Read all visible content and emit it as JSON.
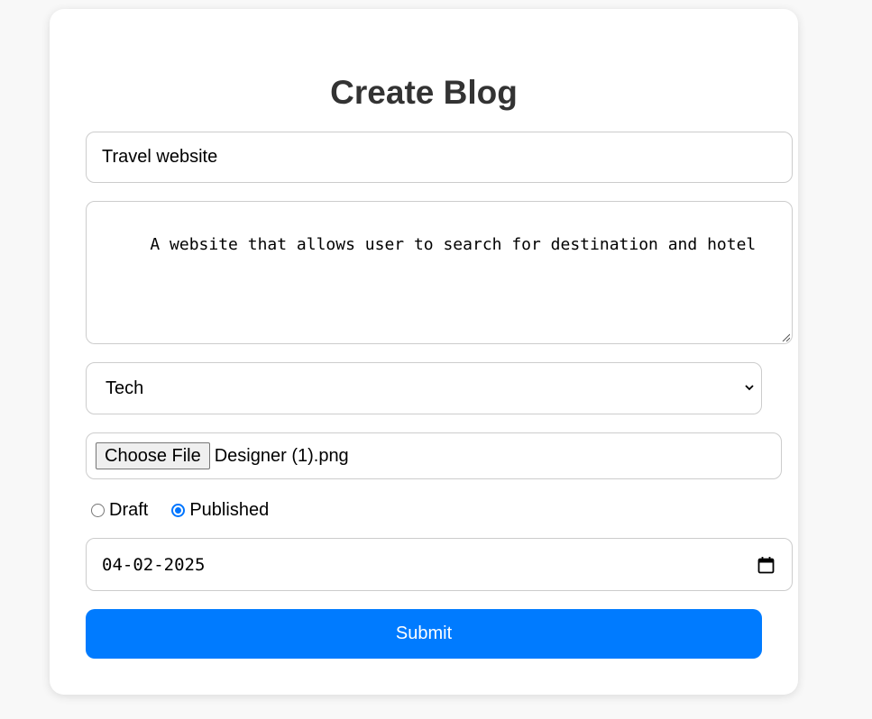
{
  "form": {
    "heading": "Create Blog",
    "title_value": "Travel website",
    "description_value": "A website that allows user to search for destination and hotel",
    "category_selected": "Tech",
    "file_button_label": "Choose File",
    "file_name": "Designer (1).png",
    "status_options": [
      {
        "label": "Draft",
        "checked": false
      },
      {
        "label": "Published",
        "checked": true
      }
    ],
    "date_value": "04-02-2025",
    "submit_label": "Submit"
  },
  "colors": {
    "accent": "#007bff",
    "radio_checked": "#0075ff",
    "page_background": "#f8f8f8",
    "heading_text": "#333333"
  },
  "icons": {
    "select": "chevron-down-icon",
    "date": "calendar-icon",
    "textarea": "resize-grip-icon"
  }
}
